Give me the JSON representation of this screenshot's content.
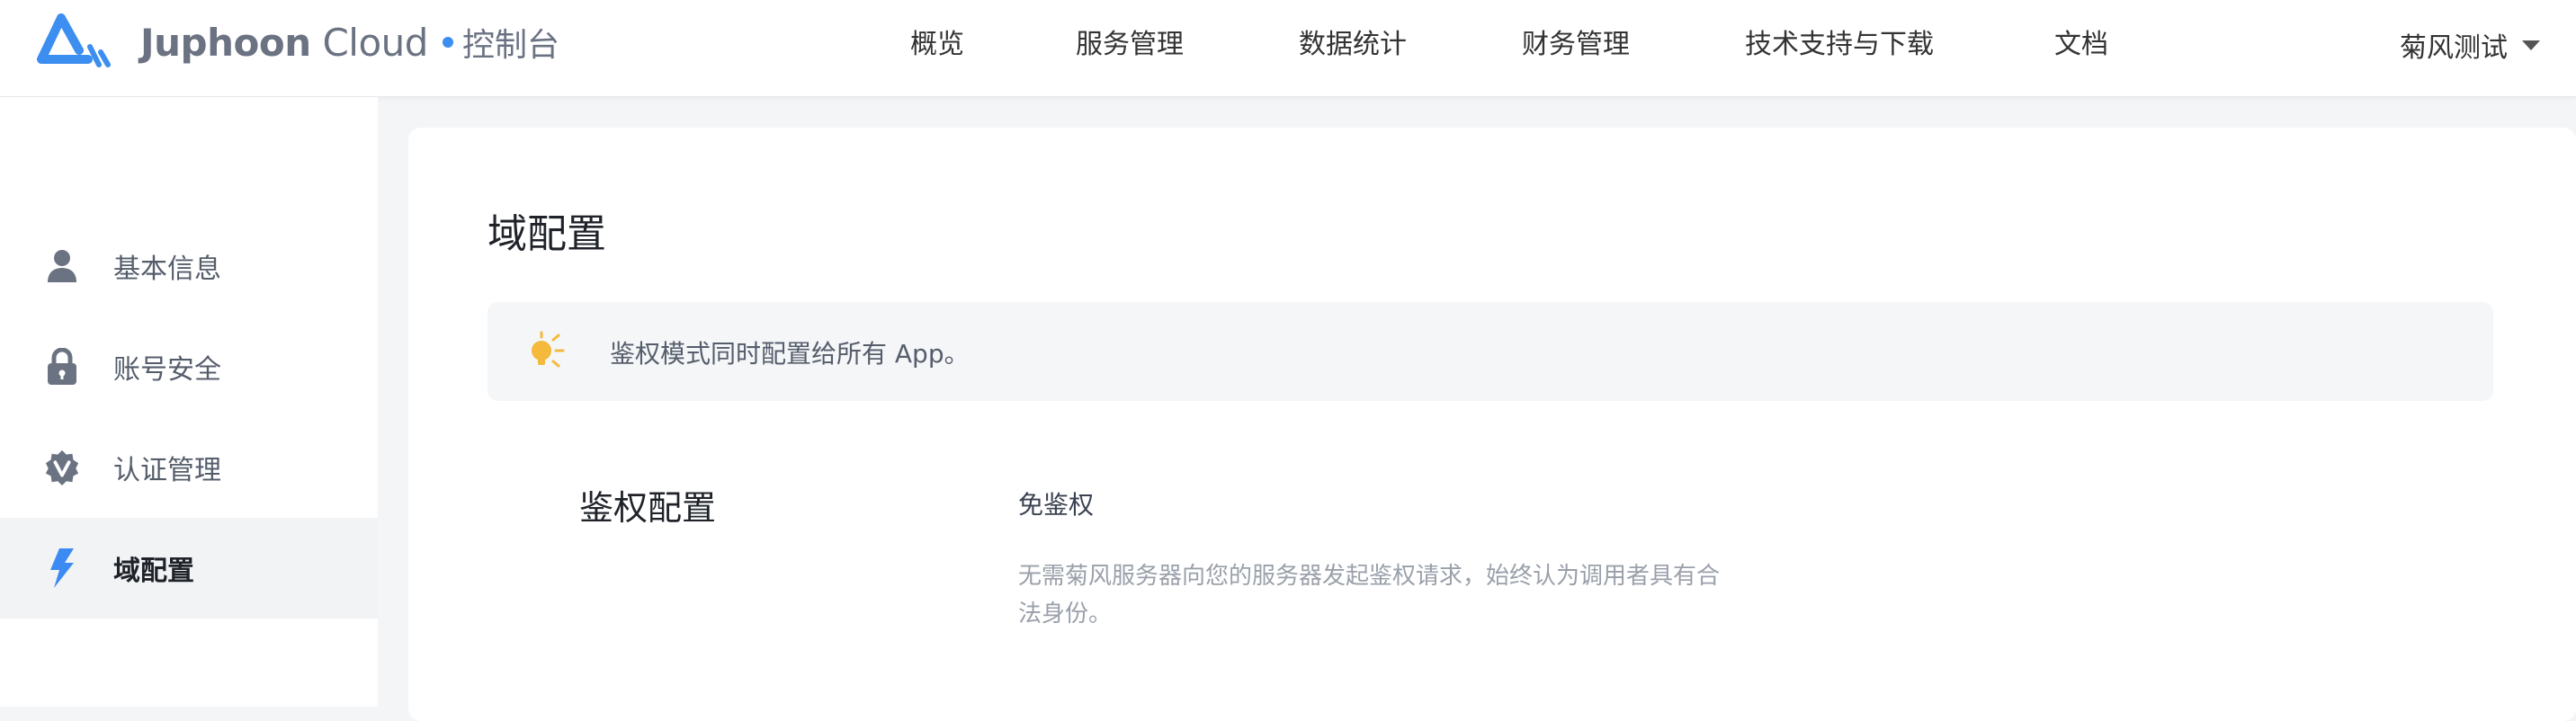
{
  "header": {
    "brand_bold": "Juphoon",
    "brand_light": " Cloud",
    "brand_sub": "控制台",
    "nav": [
      {
        "label": "概览"
      },
      {
        "label": "服务管理"
      },
      {
        "label": "数据统计"
      },
      {
        "label": "财务管理"
      },
      {
        "label": "技术支持与下载"
      },
      {
        "label": "文档"
      }
    ],
    "user_name": "菊风测试"
  },
  "sidebar": {
    "items": [
      {
        "label": "基本信息",
        "icon": "user-icon",
        "active": false
      },
      {
        "label": "账号安全",
        "icon": "lock-icon",
        "active": false
      },
      {
        "label": "认证管理",
        "icon": "verified-badge-icon",
        "active": false
      },
      {
        "label": "域配置",
        "icon": "lightning-icon",
        "active": true
      }
    ]
  },
  "main": {
    "title": "域配置",
    "tip": {
      "icon": "lightbulb-icon",
      "text": "鉴权模式同时配置给所有 App。"
    },
    "auth": {
      "label": "鉴权配置",
      "option_title": "免鉴权",
      "option_desc": "无需菊风服务器向您的服务器发起鉴权请求，始终认为调用者具有合法身份。"
    }
  },
  "colors": {
    "brand_blue": "#3c8ef0",
    "active_icon": "#3d8bf2",
    "tip_icon": "#f5b93b",
    "sidebar_icon": "#6b7383"
  }
}
